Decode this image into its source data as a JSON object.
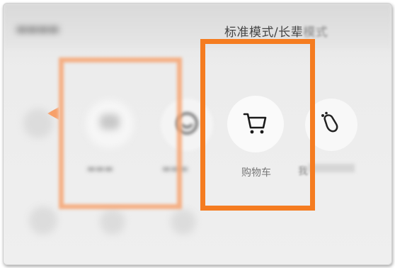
{
  "header": {
    "mode_label": "标准模式/长辈",
    "mode_label_tail": "模式"
  },
  "shortcuts": [
    {
      "label": "",
      "icon": "placeholder-icon"
    },
    {
      "label": "",
      "icon": "smile-icon"
    },
    {
      "label": "购物车",
      "icon": "shopping-cart-icon"
    },
    {
      "label": "我",
      "icon": "footprint-icon"
    }
  ],
  "highlight_colors": {
    "primary": "#f57c20",
    "secondary": "#f7a06a"
  }
}
